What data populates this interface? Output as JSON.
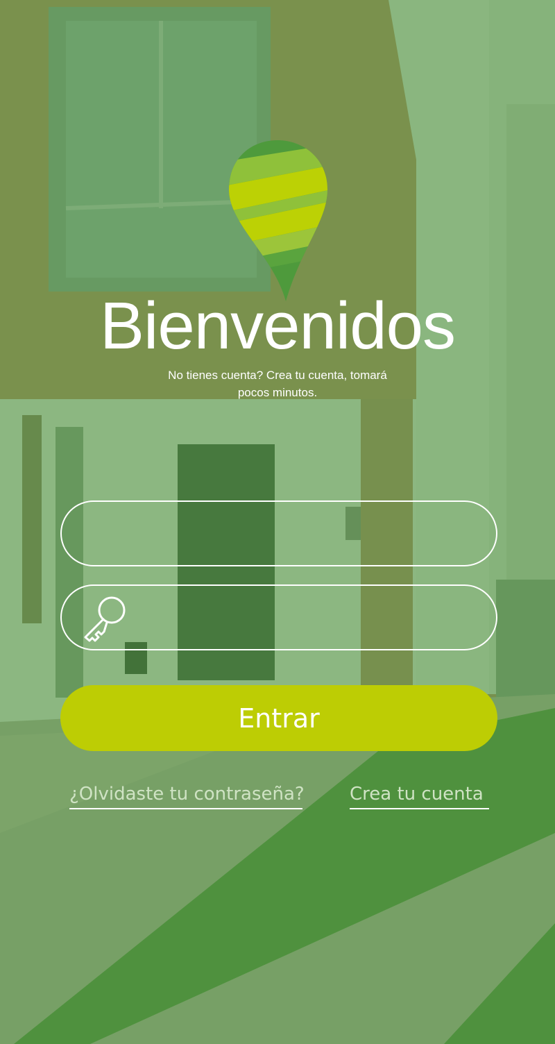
{
  "colors": {
    "overlay": "#5a9a4a",
    "accent": "#bdcd04",
    "text": "#ffffff",
    "link": "#cfe3c4"
  },
  "logo": {
    "icon": "location-pin-logo-icon"
  },
  "header": {
    "title": "Bienvenidos",
    "subtitle": "No tienes cuenta? Crea tu cuenta, tomará pocos minutos."
  },
  "form": {
    "username": {
      "value": "",
      "placeholder": ""
    },
    "password": {
      "value": "",
      "placeholder": "",
      "icon": "key-icon"
    },
    "submit_label": "Entrar"
  },
  "links": {
    "forgot_password": "¿Olvidaste tu contraseña?",
    "create_account": "Crea tu cuenta"
  }
}
